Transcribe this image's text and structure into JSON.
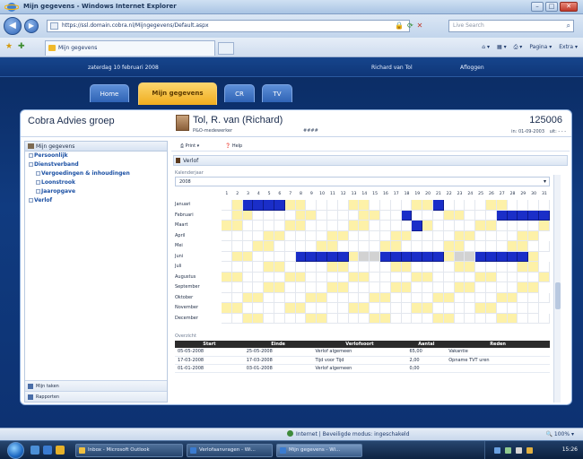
{
  "browser": {
    "title": "Mijn gegevens - Windows Internet Explorer",
    "url": "https://ssl.domain.cobra.nl/Mijngegevens/Default.aspx",
    "tab_label": "Mijn gegevens",
    "search_placeholder": "Live Search",
    "commands": [
      "Pagina ▾",
      "Extra ▾"
    ],
    "status_zone": "Internet | Beveiligde modus: ingeschakeld",
    "zoom": "100%"
  },
  "app": {
    "date": "zaterdag 10 februari 2008",
    "user": "Richard van Tol",
    "logout": "Afloggen",
    "tabs": [
      {
        "label": "Home",
        "active": false
      },
      {
        "label": "Mijn gegevens",
        "active": true
      },
      {
        "label": "CR",
        "active": false
      },
      {
        "label": "TV",
        "active": false
      }
    ]
  },
  "header": {
    "company": "Cobra Advies groep",
    "person_name": "Tol, R. van (Richard)",
    "person_role": "P&O-medewerker",
    "person_code": "####",
    "employee_number": "125006",
    "employee_date": "in: 01-09-2003",
    "employee_extra": "uit: - - -"
  },
  "sidebar": {
    "title": "Mijn gegevens",
    "items": [
      {
        "label": "Persoonlijk",
        "sub": false
      },
      {
        "label": "Dienstverband",
        "sub": false
      },
      {
        "label": "Vergoedingen & inhoudingen",
        "sub": true
      },
      {
        "label": "Loonstrook",
        "sub": true
      },
      {
        "label": "Jaaropgave",
        "sub": true
      },
      {
        "label": "Verlof",
        "sub": false
      }
    ],
    "footer": [
      "Mijn taken",
      "Rapporten"
    ]
  },
  "main": {
    "print_label": "Print ▾",
    "help_label": "Help",
    "section_title": "Verlof",
    "year_label": "Kalenderjaar",
    "year_value": "2008",
    "overview_label": "Overzicht",
    "days": [
      "1",
      "2",
      "3",
      "4",
      "5",
      "6",
      "7",
      "8",
      "9",
      "10",
      "11",
      "12",
      "13",
      "14",
      "15",
      "16",
      "17",
      "18",
      "19",
      "20",
      "21",
      "22",
      "23",
      "24",
      "25",
      "26",
      "27",
      "28",
      "29",
      "30",
      "31"
    ],
    "months": [
      {
        "name": "Januari",
        "cells": "wybbbbyywwwwyywwwwyybwwwwyywwww"
      },
      {
        "name": "Februari",
        "cells": "wyywwwwyywwwwyywwbwwwyywwwbbbbb"
      },
      {
        "name": "Maart",
        "cells": "yywwwwyywwwwyywwwwbywwwwyywwwwy"
      },
      {
        "name": "April",
        "cells": "wwwwyywwwwyywwwwyywwwwyywwwwyyn"
      },
      {
        "name": "Mei",
        "cells": "wwwyywwwwyywwwwyywwwwyywwwwyyww"
      },
      {
        "name": "Juni",
        "cells": "wyywwwwbbbbbyggbbbbbbyggbbbbbyn"
      },
      {
        "name": "Juli",
        "cells": "wwwwyywwwwyywwwwyywwwwyywwwwyyw"
      },
      {
        "name": "Augustus",
        "cells": "yywwwwyywwwwyywwwwyywwwwyywwwwy"
      },
      {
        "name": "September",
        "cells": "wwwwyywwwwyywwwwyywwwwyywwwwyyn"
      },
      {
        "name": "Oktober",
        "cells": "wwyywwwwyywwwwyywwwwyywwwwyywww"
      },
      {
        "name": "November",
        "cells": "yywwwwyywwwwyywwwwyywwwwyywwwwn"
      },
      {
        "name": "December",
        "cells": "wwyywwwwyywwwwyywwwwyywwwwyywww"
      }
    ],
    "table": {
      "headers": [
        "Start",
        "Einde",
        "Verlofsoort",
        "Aantal",
        "Reden"
      ],
      "rows": [
        [
          "05-05-2008",
          "25-05-2008",
          "Verlof algemeen",
          "65,00",
          "Vakantie"
        ],
        [
          "17-03-2008",
          "17-03-2008",
          "Tijd voor Tijd",
          "2,00",
          "Opname TVT uren"
        ],
        [
          "01-01-2008",
          "03-01-2008",
          "Verlof algemeen",
          "0,00",
          ""
        ]
      ]
    }
  },
  "taskbar": {
    "buttons": [
      "Inbox - Microsoft Outlook",
      "Verlofaanvragen - Wi...",
      "Mijn gegevens - Wi..."
    ],
    "clock": "15:26"
  }
}
